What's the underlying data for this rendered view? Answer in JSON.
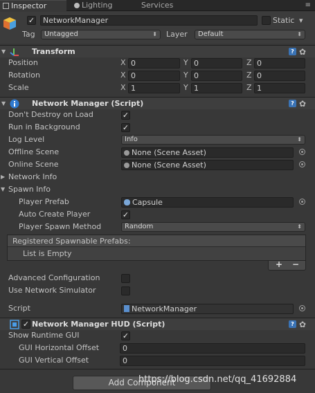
{
  "tabs": [
    {
      "label": "Inspector",
      "active": true
    },
    {
      "label": "Lighting",
      "active": false
    },
    {
      "label": "Services",
      "active": false
    }
  ],
  "tab_menu": "≡",
  "object": {
    "name": "NetworkManager",
    "active": true,
    "static_label": "Static",
    "tag_label": "Tag",
    "tag_value": "Untagged",
    "layer_label": "Layer",
    "layer_value": "Default"
  },
  "transform": {
    "title": "Transform",
    "rows": [
      {
        "label": "Position",
        "x": "0",
        "y": "0",
        "z": "0"
      },
      {
        "label": "Rotation",
        "x": "0",
        "y": "0",
        "z": "0"
      },
      {
        "label": "Scale",
        "x": "1",
        "y": "1",
        "z": "1"
      }
    ],
    "axis_labels": [
      "X",
      "Y",
      "Z"
    ]
  },
  "network_manager": {
    "title": "Network Manager (Script)",
    "dont_destroy_label": "Don't Destroy on Load",
    "run_bg_label": "Run in Background",
    "log_level_label": "Log Level",
    "log_level_value": "Info",
    "offline_scene_label": "Offline Scene",
    "offline_scene_value": "None (Scene Asset)",
    "online_scene_label": "Online Scene",
    "online_scene_value": "None (Scene Asset)",
    "network_info_label": "Network Info",
    "spawn_info_label": "Spawn Info",
    "player_prefab_label": "Player Prefab",
    "player_prefab_value": "Capsule",
    "auto_create_label": "Auto Create Player",
    "spawn_method_label": "Player Spawn Method",
    "spawn_method_value": "Random",
    "registered_label": "Registered Spawnable Prefabs:",
    "list_empty": "List is Empty",
    "add_label": "+",
    "remove_label": "−",
    "advanced_label": "Advanced Configuration",
    "simulator_label": "Use Network Simulator",
    "script_label": "Script",
    "script_value": "NetworkManager"
  },
  "hud": {
    "title": "Network Manager HUD (Script)",
    "show_gui_label": "Show Runtime GUI",
    "h_offset_label": "GUI Horizontal Offset",
    "h_offset_value": "0",
    "v_offset_label": "GUI Vertical Offset",
    "v_offset_value": "0"
  },
  "add_component_label": "Add Component",
  "watermark": "https://blog.csdn.net/qq_41692884",
  "icons": {
    "checkmark": "✓",
    "dropdown_arrow": "▾",
    "fold_open": "▼",
    "fold_closed": "▶",
    "book": "?",
    "gear": "✿"
  }
}
